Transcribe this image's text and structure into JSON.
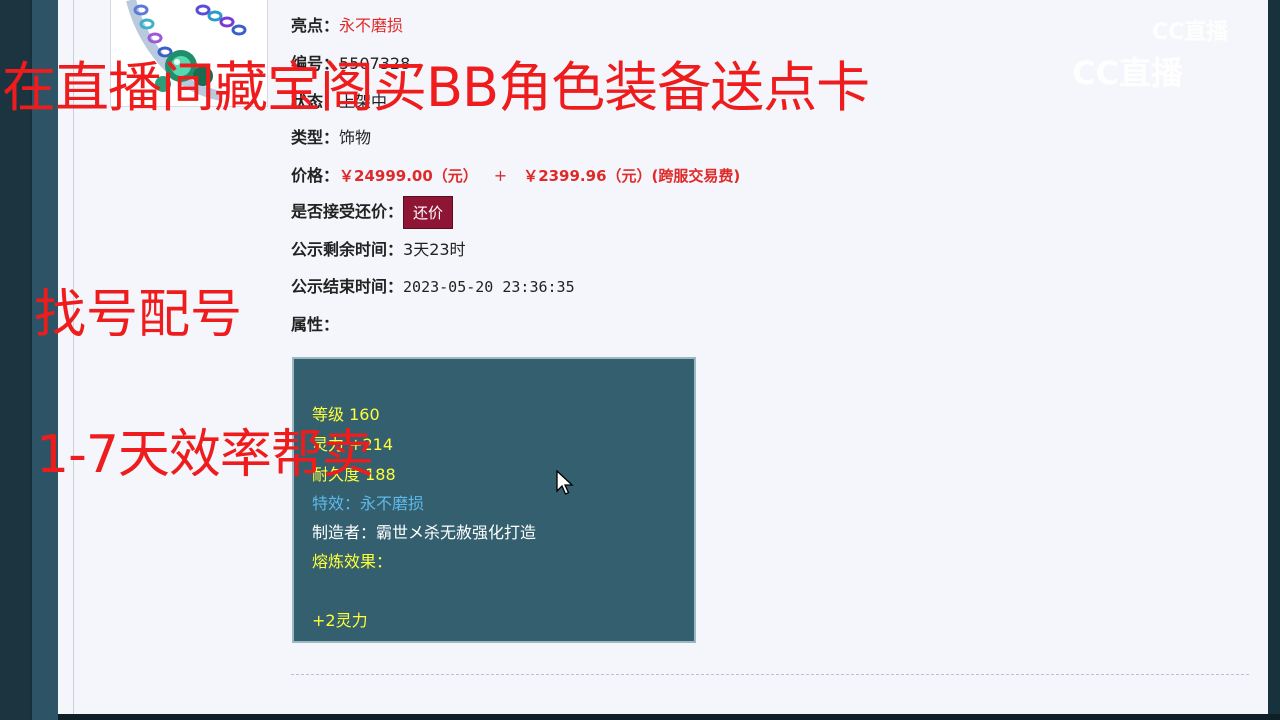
{
  "item": {
    "highlight_label": "亮点：",
    "highlight_value": "永不磨损",
    "id_label": "编号：",
    "id_value": "5507328",
    "status_label": "状态：",
    "status_value": "上架中",
    "type_label": "类型：",
    "type_value": "饰物",
    "price_label": "价格：",
    "price_main": "￥24999.00（元）",
    "price_plus": "+",
    "price_fee": "￥2399.96（元）(跨服交易费)",
    "counter_label": "是否接受还价：",
    "counter_button": "还价",
    "remaining_label": "公示剩余时间：",
    "remaining_value": "3天23时",
    "end_label": "公示结束时间：",
    "end_value": "2023-05-20 23:36:35",
    "attr_label": "属性："
  },
  "attributes": {
    "level": "等级 160",
    "stat": "灵力 +214",
    "durability": "耐久度 188",
    "effect": "特效：永不磨损",
    "maker": "制造者：霸世メ杀无赦强化打造",
    "smelt_label": "熔炼效果：",
    "smelt_value": "+2灵力"
  },
  "overlay": {
    "line1": "在直播间藏宝阁买BB角色装备送点卡",
    "line2": "找号配号",
    "line3": "1-7天效率帮卖"
  },
  "watermark": {
    "logo_small": "CC直播",
    "logo_large": "CC直播"
  },
  "colors": {
    "price_red": "#e02a2a",
    "button_bg": "#8e1634",
    "attr_box_bg": "#335f6f",
    "overlay_red": "#ee1c1c"
  }
}
